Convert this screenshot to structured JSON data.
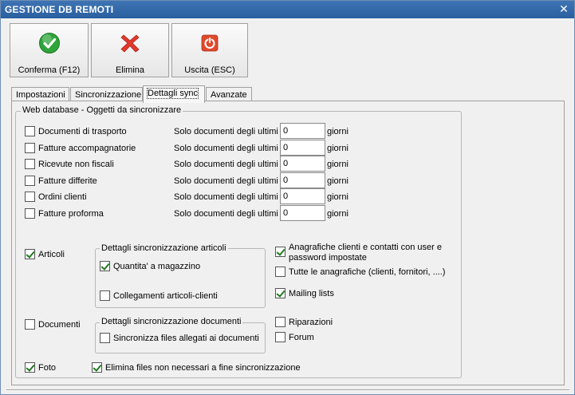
{
  "window": {
    "title": "GESTIONE DB REMOTI",
    "close_glyph": "✕"
  },
  "toolbar": {
    "confirm_label": "Conferma (F12)",
    "delete_label": "Elimina",
    "exit_label": "Uscita (ESC)",
    "confirm_icon": "check-icon",
    "delete_icon": "cross-icon",
    "exit_icon": "power-icon"
  },
  "tabs": [
    "Impostazioni",
    "Sincronizzazione",
    "Dettagli sync",
    "Avanzate"
  ],
  "main_group": {
    "legend": "Web database - Oggetti da sincronizzare"
  },
  "doc_rows": [
    {
      "label": "Documenti di trasporto",
      "checked": false,
      "days_label": "Solo documenti degli ultimi",
      "value": "0",
      "unit": "giorni"
    },
    {
      "label": "Fatture accompagnatorie",
      "checked": false,
      "days_label": "Solo documenti degli ultimi",
      "value": "0",
      "unit": "giorni"
    },
    {
      "label": "Ricevute non fiscali",
      "checked": false,
      "days_label": "Solo documenti degli ultimi",
      "value": "0",
      "unit": "giorni"
    },
    {
      "label": "Fatture differite",
      "checked": false,
      "days_label": "Solo documenti degli ultimi",
      "value": "0",
      "unit": "giorni"
    },
    {
      "label": "Ordini clienti",
      "checked": false,
      "days_label": "Solo documenti degli ultimi",
      "value": "0",
      "unit": "giorni"
    },
    {
      "label": "Fatture proforma",
      "checked": false,
      "days_label": "Solo documenti degli ultimi",
      "value": "0",
      "unit": "giorni"
    }
  ],
  "articoli": {
    "label": "Articoli",
    "checked": true,
    "group_legend": "Dettagli sincronizzazione articoli",
    "quantita_label": "Quantita' a magazzino",
    "quantita_checked": true,
    "collegamenti_label": "Collegamenti articoli-clienti",
    "collegamenti_checked": false
  },
  "documenti": {
    "label": "Documenti",
    "checked": false,
    "group_legend": "Dettagli sincronizzazione documenti",
    "allegati_label": "Sincronizza files allegati ai documenti",
    "allegati_checked": false
  },
  "foto": {
    "label": "Foto",
    "checked": true,
    "elimina_label": "Elimina files non necessari a fine sincronizzazione",
    "elimina_checked": true
  },
  "right_options": {
    "anagrafiche_line1": "Anagrafiche clienti e contatti con user e",
    "anagrafiche_line2": "password impostate",
    "anagrafiche_checked": true,
    "tutte_label": "Tutte le anagrafiche (clienti, fornitori, ....)",
    "tutte_checked": false,
    "mailing_label": "Mailing lists",
    "mailing_checked": true,
    "riparazioni_label": "Riparazioni",
    "riparazioni_checked": false,
    "forum_label": "Forum",
    "forum_checked": false
  },
  "colors": {
    "title_bar": "#2a5fa0",
    "check_green": "#2ea43a",
    "cross_red": "#e0392b",
    "power_red": "#e04a2a"
  }
}
